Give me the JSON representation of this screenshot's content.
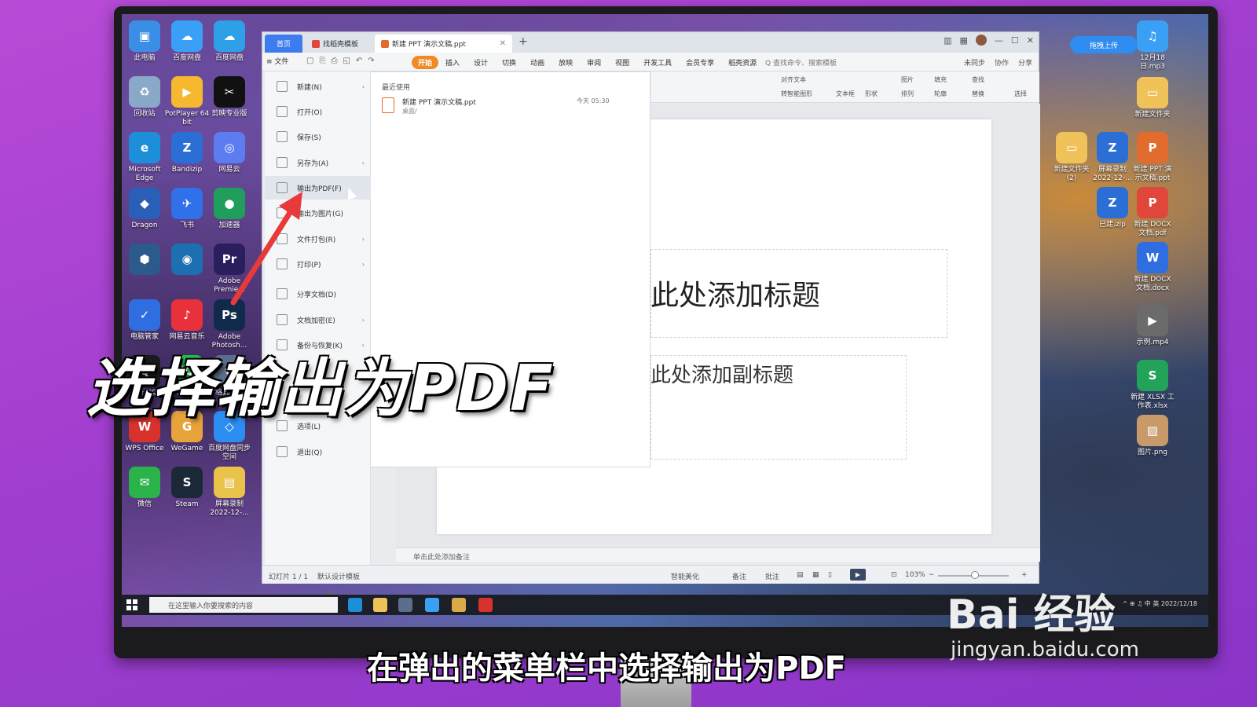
{
  "desktop": {
    "icons_left": [
      {
        "label": "此电脑",
        "color": "#3a8ee6",
        "glyph": "▣"
      },
      {
        "label": "百度网盘",
        "color": "#3aa0f5",
        "glyph": "☁"
      },
      {
        "label": "百度网盘",
        "color": "#2ea0e8",
        "glyph": "☁"
      },
      {
        "label": "回收站",
        "color": "#8aa9c9",
        "glyph": "♻"
      },
      {
        "label": "PotPlayer 64 bit",
        "color": "#f5b82e",
        "glyph": "▶"
      },
      {
        "label": "剪映专业版",
        "color": "#111111",
        "glyph": "✂"
      },
      {
        "label": "Microsoft Edge",
        "color": "#1d8fd8",
        "glyph": "e"
      },
      {
        "label": "Bandizip",
        "color": "#2b6fd6",
        "glyph": "Z"
      },
      {
        "label": "网易云",
        "color": "#5c7cf0",
        "glyph": "◎"
      },
      {
        "label": "Dragon",
        "color": "#2a5fb8",
        "glyph": "◆"
      },
      {
        "label": "飞书",
        "color": "#3070e8",
        "glyph": "✈"
      },
      {
        "label": "加速器",
        "color": "#1f9e5c",
        "glyph": "●"
      },
      {
        "label": "",
        "color": "#2c5a8a",
        "glyph": "⬢"
      },
      {
        "label": "",
        "color": "#1c6fb0",
        "glyph": "◉"
      },
      {
        "label": "Adobe Premie...",
        "color": "#2a1f5c",
        "glyph": "Pr"
      },
      {
        "label": "电脑管家",
        "color": "#2f6ee0",
        "glyph": "✓"
      },
      {
        "label": "网易云音乐",
        "color": "#e8313b",
        "glyph": "♪"
      },
      {
        "label": "Adobe Photosh...",
        "color": "#0f2a4a",
        "glyph": "Ps"
      },
      {
        "label": "腾讯QQ",
        "color": "#1b1b1b",
        "glyph": "Q"
      },
      {
        "label": "爱奇艺",
        "color": "#1fbf4a",
        "glyph": "iQ"
      },
      {
        "label": "格式工厂",
        "color": "#5b6e8a",
        "glyph": "⚙"
      },
      {
        "label": "WPS Office",
        "color": "#d8322c",
        "glyph": "W"
      },
      {
        "label": "WeGame",
        "color": "#e8a33a",
        "glyph": "G"
      },
      {
        "label": "百度网盘同步空间",
        "color": "#2b8ef0",
        "glyph": "◇"
      },
      {
        "label": "微信",
        "color": "#2ab24b",
        "glyph": "✉"
      },
      {
        "label": "Steam",
        "color": "#1b2838",
        "glyph": "S"
      },
      {
        "label": "屏幕录制 2022-12-...",
        "color": "#e8c24a",
        "glyph": "▤"
      }
    ],
    "icons_right": [
      {
        "label": "12月18日.mp3",
        "color": "#3aa0f5",
        "glyph": "♫"
      },
      {
        "label": "新建文件夹",
        "color": "#f0c25a",
        "glyph": "▭"
      },
      {
        "label": "新建文件夹 (2)",
        "color": "#f0c25a",
        "glyph": "▭"
      },
      {
        "label": "屏幕录制 2022-12-...",
        "color": "#2b6fd6",
        "glyph": "Z"
      },
      {
        "label": "新建 PPT 演示文稿.ppt",
        "color": "#e26b2e",
        "glyph": "P"
      },
      {
        "label": "已建.zip",
        "color": "#2b6fd6",
        "glyph": "Z"
      },
      {
        "label": "新建 DOCX 文档.pdf",
        "color": "#e0463a",
        "glyph": "P"
      },
      {
        "label": "新建 DOCX 文档.docx",
        "color": "#2f6ee0",
        "glyph": "W"
      },
      {
        "label": "示例.mp4",
        "color": "#6b6b6b",
        "glyph": "▶"
      },
      {
        "label": "新建 XLSX 工作表.xlsx",
        "color": "#23a35a",
        "glyph": "S"
      },
      {
        "label": "图片.png",
        "color": "#c89a6a",
        "glyph": "▨"
      }
    ],
    "cloud_upload_label": "拖拽上传"
  },
  "wps": {
    "tabs": {
      "home": "首页",
      "template": "找稻壳模板",
      "doc": "新建 PPT 演示文稿.ppt"
    },
    "file_button": "≡ 文件",
    "ribbon_tabs": [
      "开始",
      "插入",
      "设计",
      "切换",
      "动画",
      "放映",
      "审阅",
      "视图",
      "开发工具",
      "会员专享",
      "稻壳资源"
    ],
    "search_label": "Q 查找命令、搜索模板",
    "ribbon_right": [
      "未同步",
      "协作",
      "分享"
    ],
    "toolbar": {
      "align_text": "对齐文本",
      "smartart": "转智能图形",
      "textbox": "文本框",
      "shape": "形状",
      "picture": "图片",
      "fill": "填充",
      "arrange": "排列",
      "outline": "轮廓",
      "find": "查找",
      "replace": "替换",
      "select": "选择"
    },
    "file_menu": [
      {
        "label": "新建(N)",
        "has_arrow": true
      },
      {
        "label": "打开(O)",
        "has_arrow": false
      },
      {
        "label": "保存(S)",
        "has_arrow": false
      },
      {
        "label": "另存为(A)",
        "has_arrow": true
      },
      {
        "label": "输出为PDF(F)",
        "has_arrow": false
      },
      {
        "label": "输出为图片(G)",
        "has_arrow": false
      },
      {
        "label": "文件打包(R)",
        "has_arrow": true
      },
      {
        "label": "打印(P)",
        "has_arrow": true
      },
      {
        "label": "分享文档(D)",
        "has_arrow": false
      },
      {
        "label": "文档加密(E)",
        "has_arrow": true
      },
      {
        "label": "备份与恢复(K)",
        "has_arrow": true
      },
      {
        "label": "选项(L)",
        "has_arrow": false
      },
      {
        "label": "退出(Q)",
        "has_arrow": false
      }
    ],
    "recent": {
      "heading": "最近使用",
      "file_name": "新建 PPT 演示文稿.ppt",
      "file_path": "桌面/",
      "file_time": "今天 05:30"
    },
    "slide": {
      "title": "此处添加标题",
      "subtitle": "此处添加副标题"
    },
    "notes_placeholder": "单击此处添加备注",
    "status": {
      "slide_count": "幻灯片 1 / 1",
      "template": "默认设计模板",
      "smart_beautify": "智能美化",
      "notes": "备注",
      "comments": "批注",
      "zoom": "103%"
    }
  },
  "taskbar": {
    "search_placeholder": "在这里输入你要搜索的内容",
    "tray": "^ ⊕ ♫ 中 英 2022/12/18"
  },
  "overlay": {
    "big_caption": "选择输出为PDF",
    "sub_caption": "在弹出的菜单栏中选择输出为PDF",
    "watermark_logo": "Bai 经验",
    "watermark_url": "jingyan.baidu.com"
  }
}
